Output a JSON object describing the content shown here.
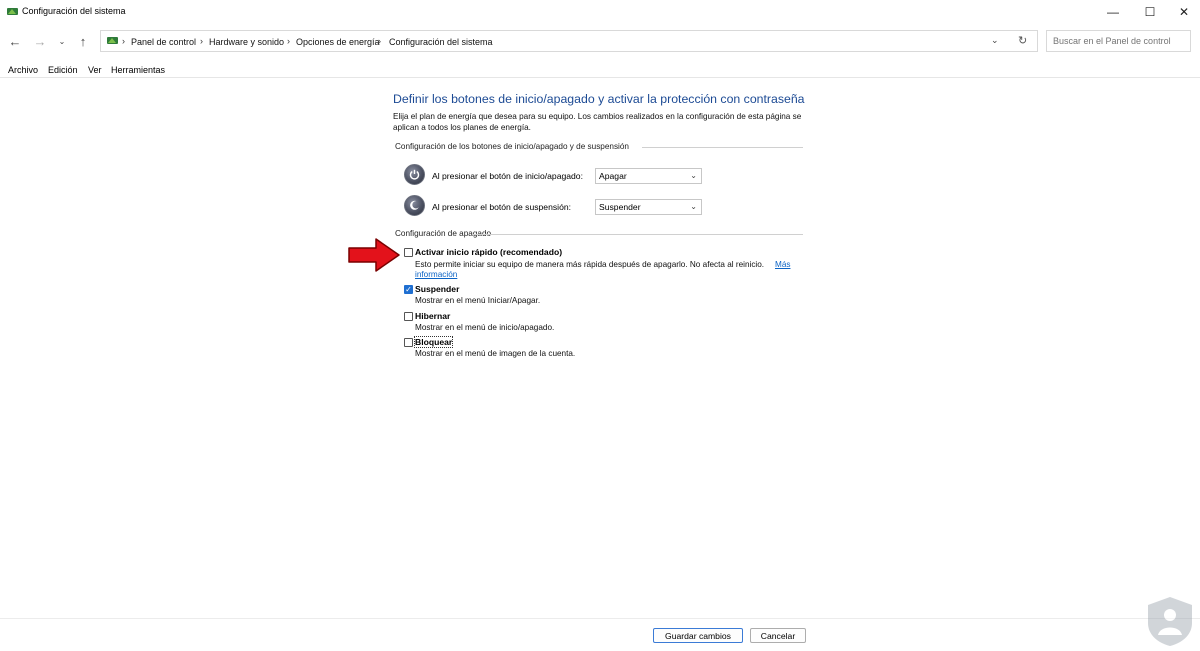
{
  "window": {
    "title": "Configuración del sistema"
  },
  "nav": {
    "breadcrumbs": [
      "Panel de control",
      "Hardware y sonido",
      "Opciones de energía",
      "Configuración del sistema"
    ],
    "search_placeholder": "Buscar en el Panel de control"
  },
  "menu": [
    "Archivo",
    "Edición",
    "Ver",
    "Herramientas"
  ],
  "main": {
    "heading": "Definir los botones de inicio/apagado y activar la protección con contraseña",
    "intro": "Elija el plan de energía que desea para su equipo. Los cambios realizados en la configuración de esta página se aplican a todos los planes de energía.",
    "buttons_group": {
      "title": "Configuración de los botones de inicio/apagado y de suspensión",
      "rows": [
        {
          "label": "Al presionar el botón de inicio/apagado:",
          "value": "Apagar"
        },
        {
          "label": "Al presionar el botón de suspensión:",
          "value": "Suspender"
        }
      ]
    },
    "shutdown_group": {
      "title": "Configuración de apagado",
      "options": [
        {
          "label": "Activar inicio rápido (recomendado)",
          "desc": "Esto permite iniciar su equipo de manera más rápida después de apagarlo. No afecta al reinicio.",
          "link": "Más",
          "link2": "información",
          "checked": false
        },
        {
          "label": "Suspender",
          "desc": "Mostrar en el menú Iniciar/Apagar.",
          "checked": true
        },
        {
          "label": "Hibernar",
          "desc": "Mostrar en el menú de inicio/apagado.",
          "checked": false
        },
        {
          "label": "Bloquear",
          "desc": "Mostrar en el menú de imagen de la cuenta.",
          "checked": false
        }
      ]
    }
  },
  "footer": {
    "save": "Guardar cambios",
    "cancel": "Cancelar"
  },
  "colors": {
    "heading": "#1c4a94",
    "link": "#0b63c5",
    "check_accent": "#1f6fd1",
    "arrow": "#e3121b"
  }
}
